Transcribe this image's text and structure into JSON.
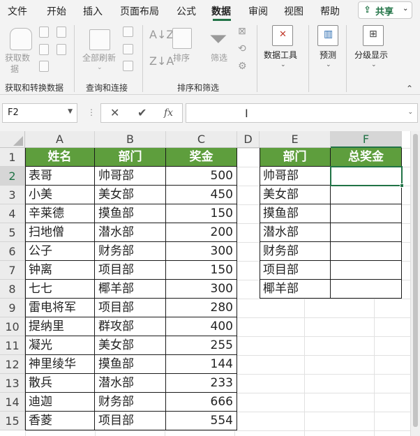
{
  "menu": {
    "items": [
      "文件",
      "开始",
      "插入",
      "页面布局",
      "公式",
      "数据",
      "审阅",
      "视图",
      "帮助"
    ],
    "active": "数据",
    "share_label": "共享"
  },
  "ribbon": {
    "get_data_label_1": "获取数",
    "get_data_label_2": "据",
    "refresh_all_label": "全部刷新",
    "sort_label": "排序",
    "filter_label": "筛选",
    "data_tools_label": "数据工具",
    "forecast_label": "预测",
    "outline_label": "分级显示",
    "groups": {
      "get_transform": "获取和转换数据",
      "queries": "查询和连接",
      "sort_filter": "排序和筛选"
    }
  },
  "formula_bar": {
    "name_box": "F2",
    "cancel_symbol": "✕",
    "enter_symbol": "✔",
    "fx_symbol": "fx",
    "formula": ""
  },
  "sheet": {
    "columns": [
      "A",
      "B",
      "C",
      "D",
      "E",
      "F"
    ],
    "rows": [
      "1",
      "2",
      "3",
      "4",
      "5",
      "6",
      "7",
      "8",
      "9",
      "10",
      "11",
      "12",
      "13",
      "14",
      "15"
    ],
    "selected_cell": "F2",
    "table1": {
      "headers": [
        "姓名",
        "部门",
        "奖金"
      ],
      "rows": [
        [
          "表哥",
          "帅哥部",
          "500"
        ],
        [
          "小美",
          "美女部",
          "450"
        ],
        [
          "辛莱德",
          "摸鱼部",
          "150"
        ],
        [
          "扫地僧",
          "潜水部",
          "200"
        ],
        [
          "公子",
          "财务部",
          "300"
        ],
        [
          "钟离",
          "项目部",
          "150"
        ],
        [
          "七七",
          "椰羊部",
          "300"
        ],
        [
          "雷电将军",
          "项目部",
          "280"
        ],
        [
          "提纳里",
          "群攻部",
          "400"
        ],
        [
          "凝光",
          "美女部",
          "255"
        ],
        [
          "神里绫华",
          "摸鱼部",
          "144"
        ],
        [
          "散兵",
          "潜水部",
          "233"
        ],
        [
          "迪迦",
          "财务部",
          "666"
        ],
        [
          "香菱",
          "项目部",
          "554"
        ]
      ]
    },
    "table2": {
      "headers": [
        "部门",
        "总奖金"
      ],
      "departments": [
        "帅哥部",
        "美女部",
        "摸鱼部",
        "潜水部",
        "财务部",
        "项目部",
        "椰羊部"
      ]
    },
    "header_fill": "#5e9e3d",
    "accent": "#217346"
  }
}
